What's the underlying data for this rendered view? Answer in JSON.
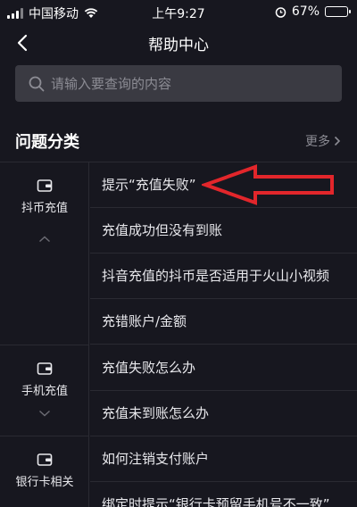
{
  "status_bar": {
    "carrier": "中国移动",
    "time": "上午9:27",
    "battery_percent": "67%",
    "battery_level": 0.67
  },
  "header": {
    "title": "帮助中心"
  },
  "search": {
    "placeholder": "请输入要查询的内容"
  },
  "section": {
    "title": "问题分类",
    "more_label": "更多"
  },
  "categories": [
    {
      "label": "抖币充值",
      "expanded": true
    },
    {
      "label": "手机充值",
      "expanded": false
    },
    {
      "label": "银行卡相关"
    }
  ],
  "questions": [
    "提示“充值失败”",
    "充值成功但没有到账",
    "抖音充值的抖币是否适用于火山小视频",
    "充错账户/金额",
    "充值失败怎么办",
    "充值未到账怎么办",
    "如何注销支付账户",
    "绑定时提示“银行卡预留手机号不一致”"
  ],
  "colors": {
    "background": "#17171f",
    "search_bg": "#3a3a42",
    "annotation_arrow": "#e2262b",
    "battery_fill": "#4cd964"
  }
}
